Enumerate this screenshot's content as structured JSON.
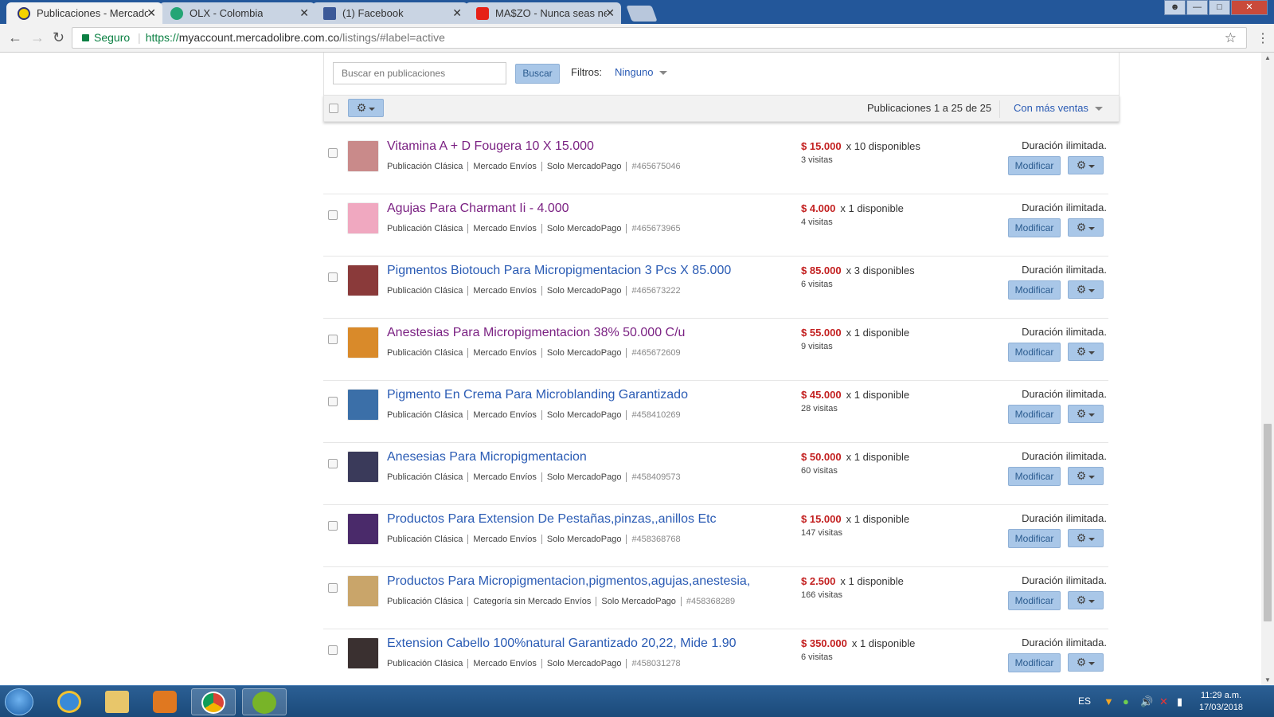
{
  "browser": {
    "tabs": [
      {
        "title": "Publicaciones - Mercado",
        "favicon_color": "#f5d100",
        "active": true
      },
      {
        "title": "OLX - Colombia",
        "favicon_color": "#24a575",
        "active": false
      },
      {
        "title": "(1) Facebook",
        "favicon_color": "#3b5998",
        "active": false
      },
      {
        "title": "MA$ZO - Nunca seas ne",
        "favicon_color": "#e62117",
        "active": false
      }
    ],
    "security_label": "Seguro",
    "url_scheme": "https://",
    "url_host": "myaccount.mercadolibre.com.co",
    "url_path": "/listings/#label=active"
  },
  "filters": {
    "search_placeholder": "Buscar en publicaciones",
    "search_button": "Buscar",
    "filters_label": "Filtros:",
    "filters_value": "Ninguno"
  },
  "toolbar": {
    "count_text": "Publicaciones 1 a 25 de 25",
    "sort_label": "Con más ventas"
  },
  "listings": [
    {
      "title": "Vitamina A + D Fougera 10 X 15.000",
      "visited": true,
      "meta": [
        "Publicación Clásica",
        "Mercado Envíos",
        "Solo MercadoPago"
      ],
      "id": "#465675046",
      "price": "$ 15.000",
      "available": "x 10 disponibles",
      "visits": "3 visitas",
      "duration": "Duración ilimitada.",
      "modify": "Modificar",
      "thumb_color": "#c98a8a"
    },
    {
      "title": "Agujas Para Charmant Ii - 4.000",
      "visited": true,
      "meta": [
        "Publicación Clásica",
        "Mercado Envíos",
        "Solo MercadoPago"
      ],
      "id": "#465673965",
      "price": "$ 4.000",
      "available": "x 1 disponible",
      "visits": "4 visitas",
      "duration": "Duración ilimitada.",
      "modify": "Modificar",
      "thumb_color": "#f0a8c0"
    },
    {
      "title": "Pigmentos Biotouch Para Micropigmentacion 3 Pcs X 85.000",
      "visited": false,
      "meta": [
        "Publicación Clásica",
        "Mercado Envíos",
        "Solo MercadoPago"
      ],
      "id": "#465673222",
      "price": "$ 85.000",
      "available": "x 3 disponibles",
      "visits": "6 visitas",
      "duration": "Duración ilimitada.",
      "modify": "Modificar",
      "thumb_color": "#8a3a3a"
    },
    {
      "title": "Anestesias Para Micropigmentacion 38% 50.000 C/u",
      "visited": true,
      "meta": [
        "Publicación Clásica",
        "Mercado Envíos",
        "Solo MercadoPago"
      ],
      "id": "#465672609",
      "price": "$ 55.000",
      "available": "x 1 disponible",
      "visits": "9 visitas",
      "duration": "Duración ilimitada.",
      "modify": "Modificar",
      "thumb_color": "#d98a2a"
    },
    {
      "title": "Pigmento En Crema Para Microblanding Garantizado",
      "visited": false,
      "meta": [
        "Publicación Clásica",
        "Mercado Envíos",
        "Solo MercadoPago"
      ],
      "id": "#458410269",
      "price": "$ 45.000",
      "available": "x 1 disponible",
      "visits": "28 visitas",
      "duration": "Duración ilimitada.",
      "modify": "Modificar",
      "thumb_color": "#3b6fa8"
    },
    {
      "title": "Anesesias Para Micropigmentacion",
      "visited": false,
      "meta": [
        "Publicación Clásica",
        "Mercado Envíos",
        "Solo MercadoPago"
      ],
      "id": "#458409573",
      "price": "$ 50.000",
      "available": "x 1 disponible",
      "visits": "60 visitas",
      "duration": "Duración ilimitada.",
      "modify": "Modificar",
      "thumb_color": "#3a3a5a"
    },
    {
      "title": "Productos Para Extension De Pestañas,pinzas,,anillos Etc",
      "visited": false,
      "meta": [
        "Publicación Clásica",
        "Mercado Envíos",
        "Solo MercadoPago"
      ],
      "id": "#458368768",
      "price": "$ 15.000",
      "available": "x 1 disponible",
      "visits": "147 visitas",
      "duration": "Duración ilimitada.",
      "modify": "Modificar",
      "thumb_color": "#4a2a6a"
    },
    {
      "title": "Productos Para Micropigmentacion,pigmentos,agujas,anestesia,",
      "visited": false,
      "meta": [
        "Publicación Clásica",
        "Categoría sin Mercado Envíos",
        "Solo MercadoPago"
      ],
      "id": "#458368289",
      "price": "$ 2.500",
      "available": "x 1 disponible",
      "visits": "166 visitas",
      "duration": "Duración ilimitada.",
      "modify": "Modificar",
      "thumb_color": "#c9a56a"
    },
    {
      "title": "Extension Cabello 100%natural Garantizado 20,22, Mide 1.90",
      "visited": false,
      "meta": [
        "Publicación Clásica",
        "Mercado Envíos",
        "Solo MercadoPago"
      ],
      "id": "#458031278",
      "price": "$ 350.000",
      "available": "x 1 disponible",
      "visits": "6 visitas",
      "duration": "Duración ilimitada.",
      "modify": "Modificar",
      "thumb_color": "#3a3030"
    }
  ],
  "taskbar": {
    "language": "ES",
    "time": "11:29 a.m.",
    "date": "17/03/2018"
  }
}
